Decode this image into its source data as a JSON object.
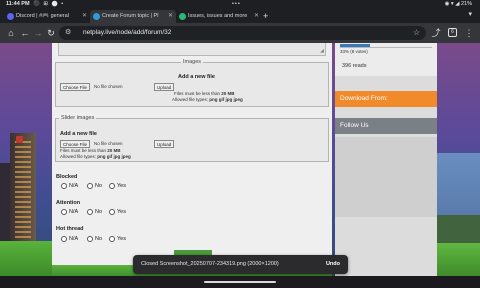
{
  "status_bar": {
    "time": "11:44 PM",
    "time_icons": "⚫ ⊞ ⬤ •",
    "center_dots": "•••",
    "right": "◉ ▾ ◢ 21%"
  },
  "tabs": [
    {
      "title": "Discord | #🎮 general",
      "favicon_color": "#5865f2",
      "active": false
    },
    {
      "title": "Create Forum topic | Pl",
      "favicon_color": "#2d9cdb",
      "active": true
    },
    {
      "title": "Issues, issues and more",
      "favicon_color": "#2bb673",
      "active": false
    }
  ],
  "tab_close_glyph": "✕",
  "new_tab_glyph": "+",
  "tab_menu_glyph": "▾",
  "toolbar": {
    "home_glyph": "⌂",
    "back_glyph": "←",
    "forward_glyph": "→",
    "reload_glyph": "↻",
    "tune_glyph": "⚙",
    "url": "netplay.live/node/add/forum/32",
    "star_glyph": "☆",
    "share_glyph": "⤴",
    "tab_count": "6",
    "menu_glyph": "⋮"
  },
  "form": {
    "resize_glyph": "◢",
    "images": {
      "legend": "Images",
      "add_heading": "Add a new file",
      "choose_label": "Choose File",
      "no_file": "No file chosen",
      "upload_label": "Upload",
      "hint_size_prefix": "Files must be less than",
      "hint_size": "20 MB",
      "hint_types_prefix": "Allowed file types:",
      "hint_types": "png gif jpg jpeg"
    },
    "slider": {
      "legend": "Slider images",
      "add_heading": "Add a new file",
      "choose_label": "Choose File",
      "no_file": "No file chosen",
      "upload_label": "Upload",
      "hint_size_prefix": "Files must be less than",
      "hint_size": "20 MB",
      "hint_types_prefix": "Allowed file types:",
      "hint_types": "png gif jpg jpeg"
    },
    "blocked": {
      "label": "Blocked",
      "options": [
        "N/A",
        "No",
        "Yes"
      ]
    },
    "attention": {
      "label": "Attention",
      "options": [
        "N/A",
        "No",
        "Yes"
      ]
    },
    "hot_thread": {
      "label": "Hot thread",
      "options": [
        "N/A",
        "No",
        "Yes"
      ]
    }
  },
  "sidebar": {
    "poll_fraction": 0.33,
    "poll_text": "33% (8 votes)",
    "reads": "396 reads",
    "download_from": "Download From:",
    "follow_us": "Follow Us",
    "download_color": "#f08a2a",
    "follow_color": "#7b7f86"
  },
  "snackbar": {
    "message": "Closed Screenshot_20250707-234319.png (2000×1200)",
    "action": "Undo"
  }
}
